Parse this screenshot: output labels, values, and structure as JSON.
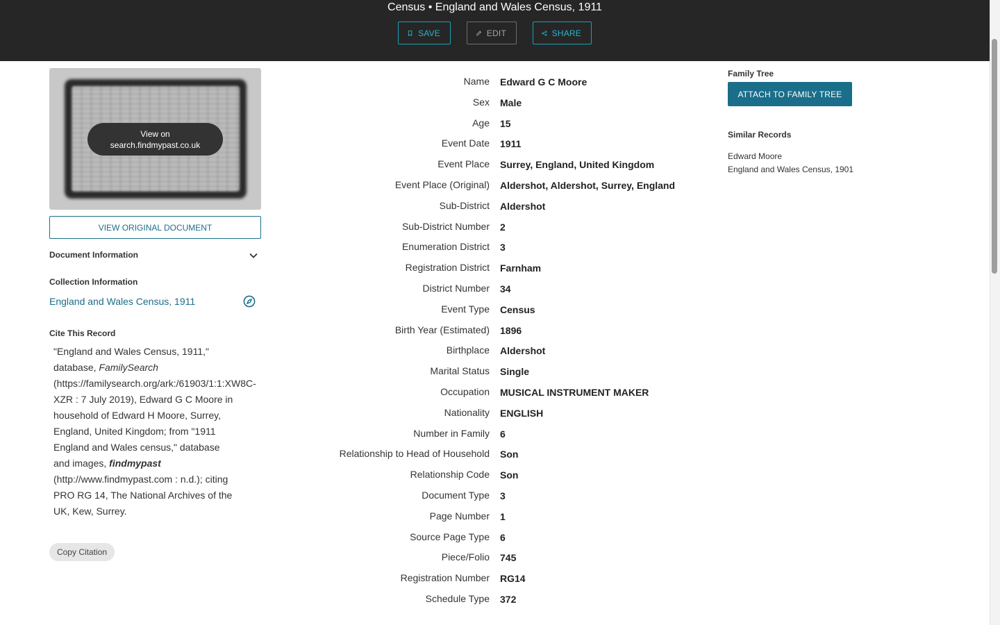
{
  "header": {
    "title": "Census • England and Wales Census, 1911",
    "save_label": "SAVE",
    "edit_label": "EDIT",
    "share_label": "SHARE"
  },
  "document": {
    "view_on_line1": "View on",
    "view_on_line2": "search.findmypast.co.uk",
    "view_original_label": "VIEW ORIGINAL DOCUMENT",
    "document_information_label": "Document Information",
    "collection_information_label": "Collection Information",
    "collection_link": "England and Wales Census, 1911",
    "cite_label": "Cite This Record",
    "copy_citation_label": "Copy Citation"
  },
  "citation": {
    "part1": "\"England and Wales Census, 1911,\" database, ",
    "italic1": "FamilySearch",
    "part2": " (https://familysearch.org/ark:/61903/1:1:XW8C-XZR : 7 July 2019), Edward G C Moore in household of Edward H Moore, Surrey, England, United Kingdom; from \"1911 England and Wales census,\" database and images, ",
    "italic2": "findmypast",
    "part3": " (http://www.findmypast.com : n.d.); citing PRO RG 14, The National Archives of the UK, Kew, Surrey."
  },
  "fields": [
    {
      "label": "Name",
      "value": "Edward G C Moore"
    },
    {
      "label": "Sex",
      "value": "Male"
    },
    {
      "label": "Age",
      "value": "15"
    },
    {
      "label": "Event Date",
      "value": "1911"
    },
    {
      "label": "Event Place",
      "value": "Surrey, England, United Kingdom"
    },
    {
      "label": "Event Place (Original)",
      "value": "Aldershot, Aldershot, Surrey, England"
    },
    {
      "label": "Sub-District",
      "value": "Aldershot"
    },
    {
      "label": "Sub-District Number",
      "value": "2"
    },
    {
      "label": "Enumeration District",
      "value": "3"
    },
    {
      "label": "Registration District",
      "value": "Farnham"
    },
    {
      "label": "District Number",
      "value": "34"
    },
    {
      "label": "Event Type",
      "value": "Census"
    },
    {
      "label": "Birth Year (Estimated)",
      "value": "1896"
    },
    {
      "label": "Birthplace",
      "value": "Aldershot"
    },
    {
      "label": "Marital Status",
      "value": "Single"
    },
    {
      "label": "Occupation",
      "value": "MUSICAL INSTRUMENT MAKER"
    },
    {
      "label": "Nationality",
      "value": "ENGLISH"
    },
    {
      "label": "Number in Family",
      "value": "6"
    },
    {
      "label": "Relationship to Head of Household",
      "value": "Son"
    },
    {
      "label": "Relationship Code",
      "value": "Son"
    },
    {
      "label": "Document Type",
      "value": "3"
    },
    {
      "label": "Page Number",
      "value": "1"
    },
    {
      "label": "Source Page Type",
      "value": "6"
    },
    {
      "label": "Piece/Folio",
      "value": "745"
    },
    {
      "label": "Registration Number",
      "value": "RG14"
    },
    {
      "label": "Schedule Type",
      "value": "372"
    }
  ],
  "right": {
    "family_tree_label": "Family Tree",
    "attach_label": "ATTACH TO FAMILY TREE",
    "similar_records_label": "Similar Records",
    "similar": [
      {
        "name": "Edward Moore",
        "collection": "England and Wales Census, 1901"
      }
    ]
  },
  "colors": {
    "header_bg": "#262626",
    "accent": "#1a6e8a",
    "header_button": "#28b4cc"
  },
  "icons": [
    "bookmark-icon",
    "pencil-icon",
    "share-icon",
    "chevron-down-icon",
    "compass-icon"
  ]
}
